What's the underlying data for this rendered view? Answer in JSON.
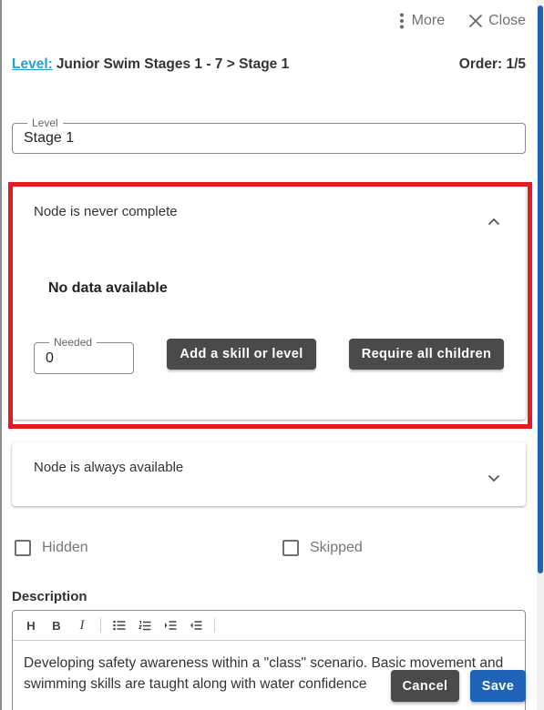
{
  "header": {
    "more_label": "More",
    "close_label": "Close"
  },
  "breadcrumb": {
    "level_link": "Level:",
    "path": "Junior Swim Stages 1 - 7 > Stage 1",
    "order": "Order: 1/5"
  },
  "level_field": {
    "label": "Level",
    "value": "Stage 1"
  },
  "completion_panel": {
    "title": "Node is never complete",
    "empty_text": "No data available",
    "needed_label": "Needed",
    "needed_value": "0",
    "add_button": "Add a skill or level",
    "require_button": "Require all children",
    "expanded": true
  },
  "availability_panel": {
    "title": "Node is always available",
    "expanded": false
  },
  "checkboxes": {
    "hidden_label": "Hidden",
    "hidden_checked": false,
    "skipped_label": "Skipped",
    "skipped_checked": false
  },
  "description": {
    "label": "Description",
    "toolbar": {
      "heading": "H",
      "bold": "B",
      "italic": "I"
    },
    "text": "Developing safety awareness within a \"class\" scenario. Basic movement and swimming skills are taught along with water confidence"
  },
  "footer": {
    "cancel_label": "Cancel",
    "save_label": "Save"
  },
  "colors": {
    "link": "#2a9fd8",
    "highlight_border": "#e31c23",
    "dark_button": "#4a4a4a",
    "primary_button": "#1e63b8"
  }
}
